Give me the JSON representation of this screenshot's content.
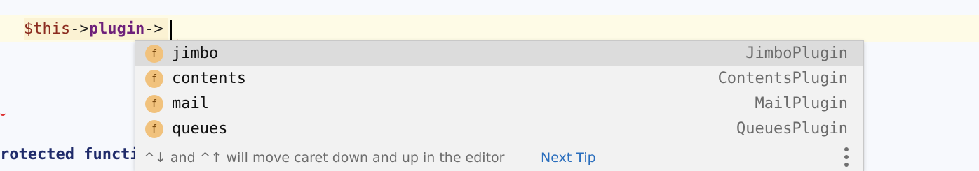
{
  "editor": {
    "line1": {
      "var": "$this",
      "arrow1": "->",
      "prop": "plugin",
      "arrow2": "->"
    },
    "line2": "rotected functi"
  },
  "completion": {
    "items": [
      {
        "badge": "f",
        "name": "jimbo",
        "type": "JimboPlugin",
        "selected": true
      },
      {
        "badge": "f",
        "name": "contents",
        "type": "ContentsPlugin"
      },
      {
        "badge": "f",
        "name": "mail",
        "type": "MailPlugin"
      },
      {
        "badge": "f",
        "name": "queues",
        "type": "QueuesPlugin"
      }
    ],
    "footer": {
      "tip": "^↓ and ^↑ will move caret down and up in the editor",
      "next_tip": "Next Tip"
    }
  },
  "colors": {
    "badge": "#f1c27d",
    "selected_row": "#dcdcdc",
    "link": "#2a6ebd",
    "line_highlight": "#fefbe6"
  }
}
